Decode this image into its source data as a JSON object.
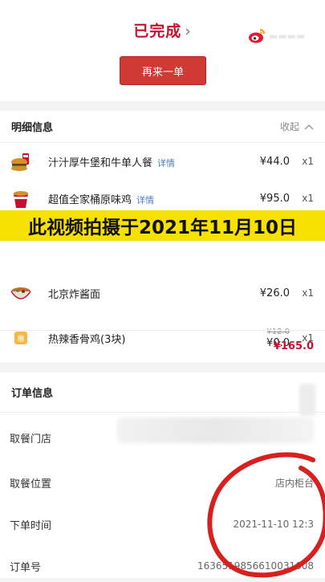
{
  "header": {
    "status": "已完成",
    "status_chevron": "›",
    "reorder_label": "再来一单"
  },
  "detail": {
    "title": "明细信息",
    "collapse_label": "收起",
    "items": [
      {
        "name": "汁汁厚牛堡和牛单人餐",
        "link": "详情",
        "price": "¥44.0",
        "qty": "x1"
      },
      {
        "name": "超值全家桶原味鸡",
        "link": "详情",
        "price": "¥95.0",
        "qty": "x1"
      },
      {
        "name": "北京炸酱面",
        "link": "",
        "price": "¥26.0",
        "qty": "x1"
      },
      {
        "name": "热辣香骨鸡(3块)",
        "link": "",
        "original_price": "¥12.0",
        "price": "¥0.0",
        "qty": "x1"
      }
    ],
    "total": "¥165.0"
  },
  "banner": {
    "text": "此视频拍摄于2021年11月10日"
  },
  "order": {
    "title": "订单信息",
    "rows": [
      {
        "label": "取餐门店",
        "value": ""
      },
      {
        "label": "取餐位置",
        "value": "店内柜台"
      },
      {
        "label": "下单时间",
        "value": "2021-11-10 12:3"
      },
      {
        "label": "订单号",
        "value": "1636519856610031608"
      }
    ]
  },
  "colors": {
    "accent": "#c8102e",
    "button": "#cf3a34",
    "banner": "#f7e100",
    "link": "#4d7bbd"
  },
  "icons": [
    "chevron-right-icon",
    "weibo-logo-icon",
    "chevron-up-icon",
    "coupon-icon",
    "red-circle-annotation"
  ]
}
